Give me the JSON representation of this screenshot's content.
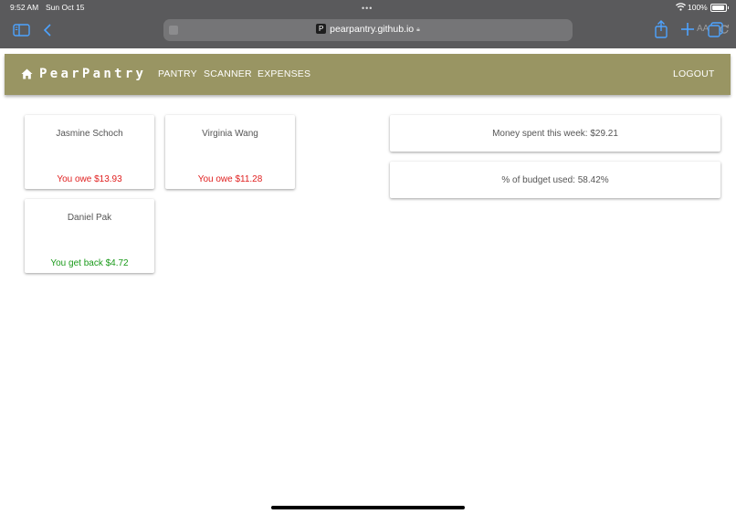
{
  "status_bar": {
    "time": "9:52 AM",
    "date": "Sun Oct 15",
    "battery": "100%"
  },
  "browser": {
    "url": "pearpantry.github.io",
    "favicon_letter": "P",
    "text_size_label": "AA"
  },
  "nav": {
    "brand": "PearPantry",
    "links": {
      "pantry": "PANTRY",
      "scanner": "SCANNER",
      "expenses": "EXPENSES"
    },
    "logout": "LOGOUT",
    "color": "#999563"
  },
  "people": [
    {
      "name": "Jasmine Schoch",
      "balance": "You owe $13.93",
      "status": "owe"
    },
    {
      "name": "Virginia Wang",
      "balance": "You owe $11.28",
      "status": "owe"
    },
    {
      "name": "Daniel Pak",
      "balance": "You get back $4.72",
      "status": "get"
    }
  ],
  "stats": {
    "money_spent": "Money spent this week: $29.21",
    "budget_used": "% of budget used: 58.42%"
  },
  "colors": {
    "owe": "#e01e1e",
    "get_back": "#1a9a1a"
  }
}
